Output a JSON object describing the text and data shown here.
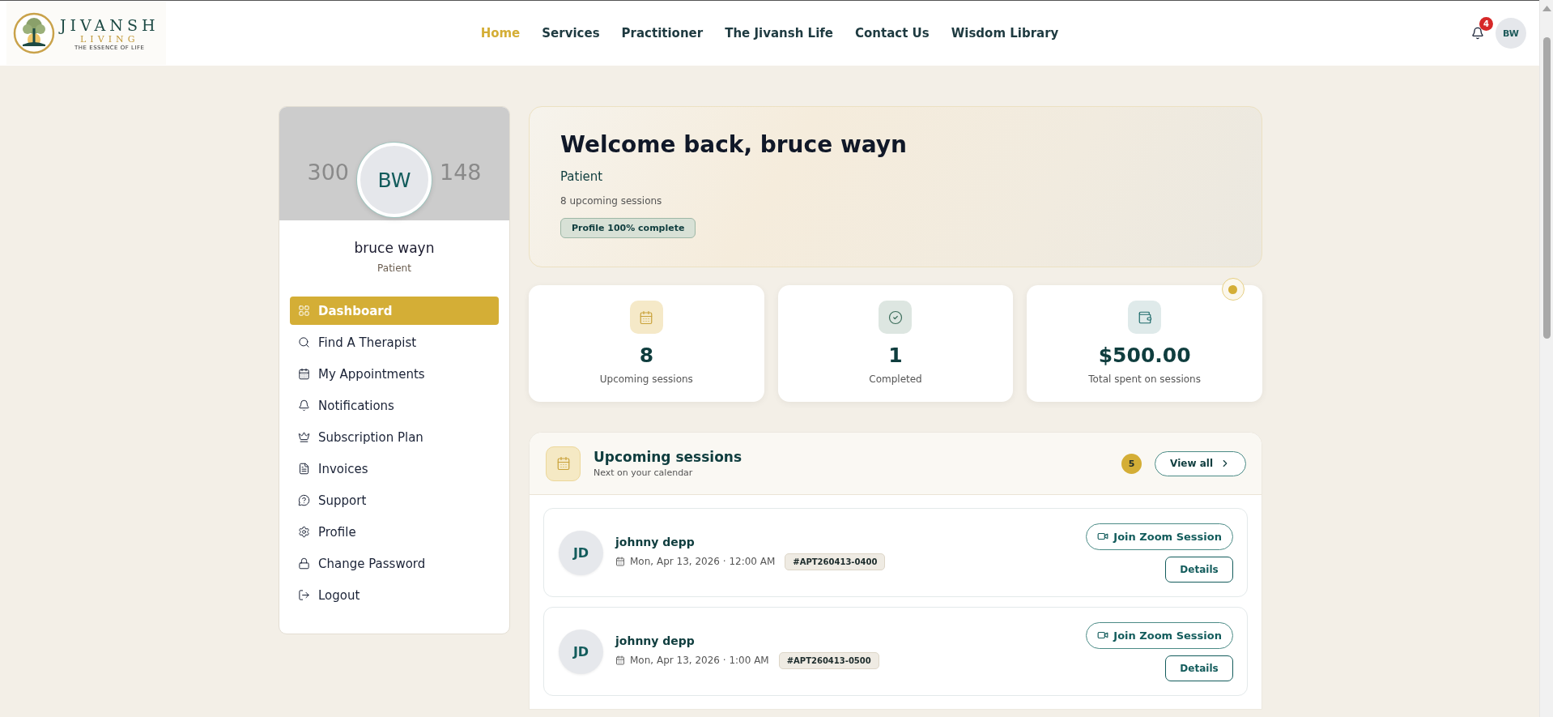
{
  "header": {
    "logo": {
      "name": "JIVANSH",
      "subtitle": "LIVING",
      "tagline": "THE ESSENCE OF LIFE"
    },
    "nav": [
      {
        "label": "Home",
        "selected": true
      },
      {
        "label": "Services",
        "selected": false
      },
      {
        "label": "Practitioner",
        "selected": false
      },
      {
        "label": "The Jivansh Life",
        "selected": false
      },
      {
        "label": "Contact Us",
        "selected": false
      },
      {
        "label": "Wisdom Library",
        "selected": false
      }
    ],
    "notification_count": "4",
    "avatar": "BW"
  },
  "sidebar": {
    "cover_text": [
      "300",
      "148"
    ],
    "avatar": "BW",
    "name": "bruce wayn",
    "role": "Patient",
    "items": [
      {
        "label": "Dashboard",
        "selected": true
      },
      {
        "label": "Find A Therapist",
        "selected": false
      },
      {
        "label": "My Appointments",
        "selected": false
      },
      {
        "label": "Notifications",
        "selected": false
      },
      {
        "label": "Subscription Plan",
        "selected": false
      },
      {
        "label": "Invoices",
        "selected": false
      },
      {
        "label": "Support",
        "selected": false
      },
      {
        "label": "Profile",
        "selected": false
      },
      {
        "label": "Change Password",
        "selected": false
      },
      {
        "label": "Logout",
        "selected": false
      }
    ]
  },
  "welcome": {
    "title": "Welcome back, bruce wayn",
    "role": "Patient",
    "summary": "8 upcoming sessions",
    "badge": "Profile 100% complete"
  },
  "stats": [
    {
      "value": "8",
      "label": "Upcoming sessions"
    },
    {
      "value": "1",
      "label": "Completed"
    },
    {
      "value": "$500.00",
      "label": "Total spent on sessions"
    }
  ],
  "sessions": {
    "title": "Upcoming sessions",
    "subtitle": "Next on your calendar",
    "count": "5",
    "view_all": "View all",
    "items": [
      {
        "initials": "JD",
        "name": "johnny depp",
        "date": "Mon, Apr 13, 2026 · 12:00 AM",
        "code": "#APT260413-0400",
        "join": "Join Zoom Session",
        "details": "Details"
      },
      {
        "initials": "JD",
        "name": "johnny depp",
        "date": "Mon, Apr 13, 2026 · 1:00 AM",
        "code": "#APT260413-0500",
        "join": "Join Zoom Session",
        "details": "Details"
      }
    ]
  }
}
